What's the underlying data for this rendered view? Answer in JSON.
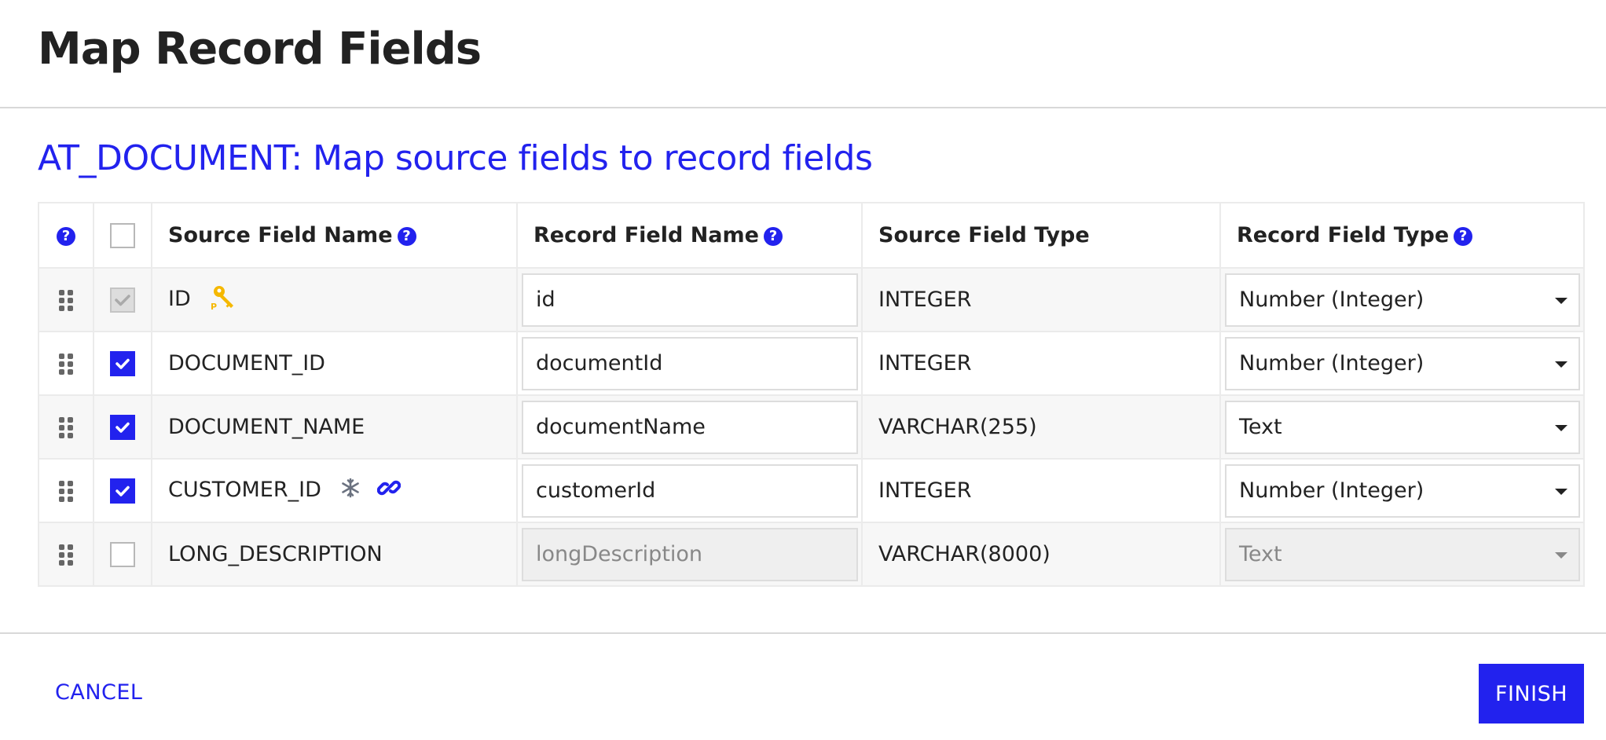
{
  "dialog": {
    "title": "Map Record Fields",
    "subtitle": "AT_DOCUMENT: Map source fields to record fields"
  },
  "table": {
    "headers": {
      "help_icon": "question-circle",
      "source_field_name": "Source Field Name",
      "record_field_name": "Record Field Name",
      "source_field_type": "Source Field Type",
      "record_field_type": "Record Field Type"
    },
    "rows": [
      {
        "source_field_name": "ID",
        "checked": true,
        "disabled": true,
        "icons": [
          "primary-key"
        ],
        "record_field_name": "id",
        "source_field_type": "INTEGER",
        "record_field_type": "Number (Integer)"
      },
      {
        "source_field_name": "DOCUMENT_ID",
        "checked": true,
        "disabled": false,
        "icons": [],
        "record_field_name": "documentId",
        "source_field_type": "INTEGER",
        "record_field_type": "Number (Integer)"
      },
      {
        "source_field_name": "DOCUMENT_NAME",
        "checked": true,
        "disabled": false,
        "icons": [],
        "record_field_name": "documentName",
        "source_field_type": "VARCHAR(255)",
        "record_field_type": "Text"
      },
      {
        "source_field_name": "CUSTOMER_ID",
        "checked": true,
        "disabled": false,
        "icons": [
          "snowflake",
          "link"
        ],
        "record_field_name": "customerId",
        "source_field_type": "INTEGER",
        "record_field_type": "Number (Integer)"
      },
      {
        "source_field_name": "LONG_DESCRIPTION",
        "checked": false,
        "disabled": false,
        "icons": [],
        "record_field_name": "longDescription",
        "source_field_type": "VARCHAR(8000)",
        "record_field_type": "Text",
        "row_inputs_disabled": true
      }
    ]
  },
  "footer": {
    "cancel_label": "CANCEL",
    "finish_label": "FINISH"
  },
  "colors": {
    "accent": "#2222ee",
    "key_icon": "#f5b800",
    "snowflake_icon": "#6b7280"
  }
}
